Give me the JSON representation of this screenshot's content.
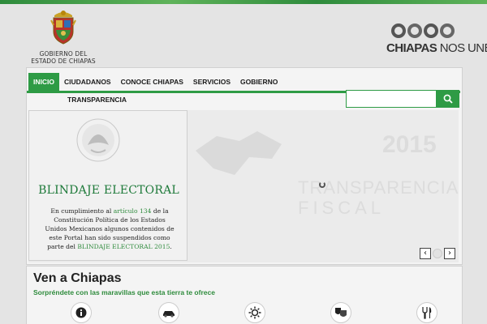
{
  "header": {
    "logo_line1": "GOBIERNO DEL",
    "logo_line2": "ESTADO DE CHIAPAS",
    "brand_bold": "CHIAPAS",
    "brand_light": "NOS UNE"
  },
  "nav": {
    "items": [
      "INICIO",
      "CIUDADANOS",
      "CONOCE CHIAPAS",
      "SERVICIOS",
      "GOBIERNO"
    ],
    "row2": [
      "TRANSPARENCIA"
    ],
    "active": "INICIO"
  },
  "search": {
    "value": "",
    "placeholder": ""
  },
  "slider": {
    "bg_year": "2015",
    "bg_word1": "TRANSPARENCIA",
    "bg_word2": "FISCAL",
    "notice_title": "BLINDAJE ELECTORAL",
    "notice_body_1": "En cumplimiento al ",
    "notice_link_1": "artículo 134",
    "notice_body_2": " de la Constitución Política de los Estados Unidos Mexicanos algunos contenidos de este Portal han sido suspendidos como parte del ",
    "notice_link_2": "BLINDAJE ELECTORAL 2015",
    "notice_body_3": "."
  },
  "ven": {
    "title": "Ven a Chiapas",
    "subtitle": "Sorpréndete con las maravillas que esta tierra te ofrece",
    "icons": [
      "info-icon",
      "car-icon",
      "sun-icon",
      "theater-masks-icon",
      "fork-knife-icon"
    ]
  },
  "colors": {
    "green": "#2e9b45",
    "dark_green": "#1e7a3a"
  }
}
